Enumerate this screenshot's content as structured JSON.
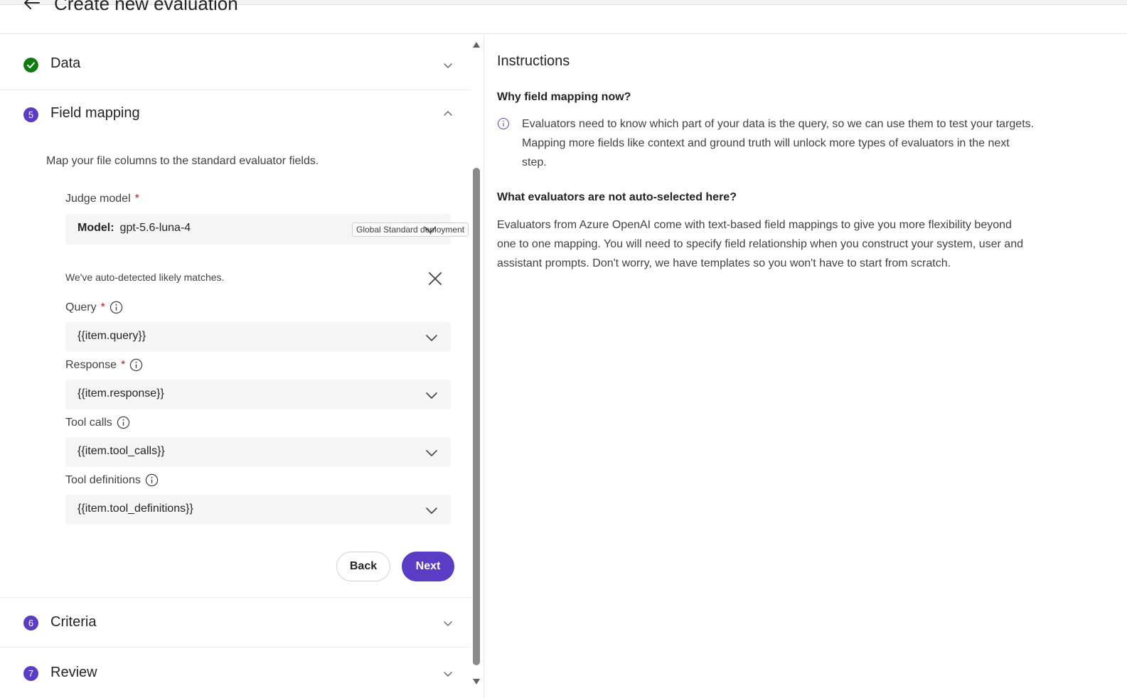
{
  "header": {
    "title": "Create new evaluation"
  },
  "sections": {
    "data": {
      "label": "Data"
    },
    "field_mapping": {
      "number": "5",
      "label": "Field mapping",
      "description": "Map your file columns to the standard evaluator fields.",
      "judge_model": {
        "label": "Judge model",
        "required_mark": "*",
        "model_key": "Model:",
        "model_value": "gpt-5.6-luna-4",
        "deployment_badge": "Global Standard deployment"
      },
      "autodetect_text": "We've auto-detected likely matches.",
      "fields": [
        {
          "label": "Query",
          "required_mark": "*",
          "value": "{{item.query}}"
        },
        {
          "label": "Response",
          "required_mark": "*",
          "value": "{{item.response}}"
        },
        {
          "label": "Tool calls",
          "required_mark": "",
          "value": "{{item.tool_calls}}"
        },
        {
          "label": "Tool definitions",
          "required_mark": "",
          "value": "{{item.tool_definitions}}"
        }
      ],
      "back_label": "Back",
      "next_label": "Next"
    },
    "criteria": {
      "number": "6",
      "label": "Criteria"
    },
    "review": {
      "number": "7",
      "label": "Review"
    }
  },
  "instructions": {
    "title": "Instructions",
    "why_heading": "Why field mapping now?",
    "why_lines": [
      "Evaluators need to know which part of your data is the query, so we can use them to test your targets.",
      "Mapping more fields like context and ground truth will unlock more types of evaluators in the next",
      "step."
    ],
    "what_heading": "What evaluators are not auto-selected here?",
    "what_lines": [
      "Evaluators from Azure OpenAI come with text-based field mappings to give you more flexibility beyond",
      "one to one mapping. You will need to specify field relationship when you construct your system, user and",
      "assistant prompts. Don't worry, we have templates so you won't have to start from scratch."
    ]
  },
  "colors": {
    "accent": "#5b3cc4",
    "success": "#107c10",
    "required": "#c50f1f"
  }
}
